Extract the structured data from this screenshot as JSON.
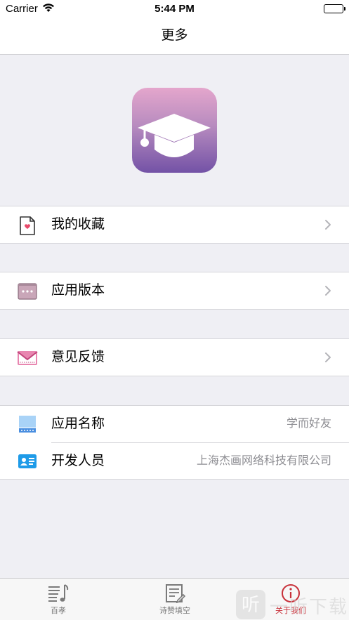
{
  "status_bar": {
    "carrier": "Carrier",
    "time": "5:44 PM"
  },
  "nav": {
    "title": "更多"
  },
  "menu": {
    "favorites": {
      "label": "我的收藏"
    },
    "version": {
      "label": "应用版本"
    },
    "feedback": {
      "label": "意见反馈"
    }
  },
  "info": {
    "app_name": {
      "label": "应用名称",
      "value": "学而好友"
    },
    "developer": {
      "label": "开发人员",
      "value": "上海杰画网络科技有限公司"
    }
  },
  "tabs": [
    {
      "label": "百孝",
      "icon": "music-list-icon",
      "active": false
    },
    {
      "label": "诗赞填空",
      "icon": "edit-document-icon",
      "active": false
    },
    {
      "label": "关于我们",
      "icon": "info-circle-icon",
      "active": true
    }
  ],
  "watermark": {
    "box": "听",
    "text": "一听下载"
  },
  "colors": {
    "accent": "#c8313a",
    "logo_top": "#e4a6cc",
    "logo_bottom": "#7352a6"
  }
}
